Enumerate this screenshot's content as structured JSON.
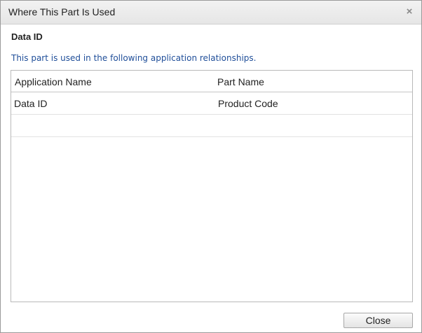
{
  "dialog": {
    "title": "Where This Part Is Used",
    "close_icon": "×"
  },
  "section": {
    "title": "Data ID",
    "info": "This part is used in the following application relationships."
  },
  "table": {
    "columns": [
      "Application Name",
      "Part Name"
    ],
    "rows": [
      [
        "Data ID",
        "Product Code"
      ],
      [
        "",
        ""
      ]
    ]
  },
  "footer": {
    "close_label": "Close"
  }
}
